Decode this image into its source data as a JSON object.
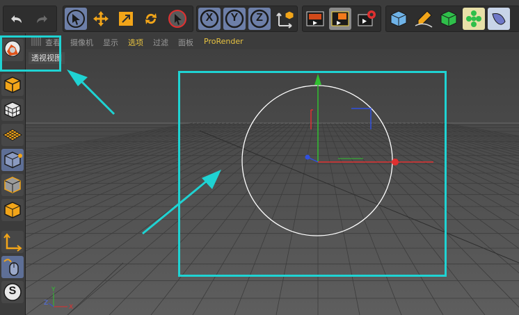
{
  "viewport": {
    "menus": [
      "查看",
      "摄像机",
      "显示",
      "选项",
      "过滤",
      "面板",
      "ProRender"
    ],
    "active_menu": "选项",
    "title": "透视视图"
  },
  "toolbar": {
    "undo_icon": "undo-icon",
    "redo_icon": "redo-icon",
    "select_icon": "select-arrow-icon",
    "move_icon": "move-icon",
    "scale_icon": "scale-icon",
    "rotate_icon": "rotate-icon",
    "live_select_icon": "live-select-icon",
    "axis_x": "X",
    "axis_y": "Y",
    "axis_z": "Z",
    "coord_icon": "coordinate-system-icon",
    "render_view_icon": "render-view-icon",
    "render_picture_icon": "render-picture-icon",
    "render_settings_icon": "render-settings-icon",
    "cube_icon": "cube-icon",
    "pen_icon": "pen-icon",
    "subdivide_icon": "subdivision-icon",
    "cloner_icon": "cloner-icon",
    "deformer_icon": "deformer-icon"
  },
  "sidebar": {
    "snap_label": "S"
  },
  "axes_gizmo": {
    "x": "X",
    "y": "Y",
    "z": "Z"
  },
  "colors": {
    "accent": "#1fd3d3",
    "menu_active": "#e8c340",
    "axis_x": "#e03030",
    "axis_y": "#30c030",
    "axis_z": "#3050e0"
  }
}
